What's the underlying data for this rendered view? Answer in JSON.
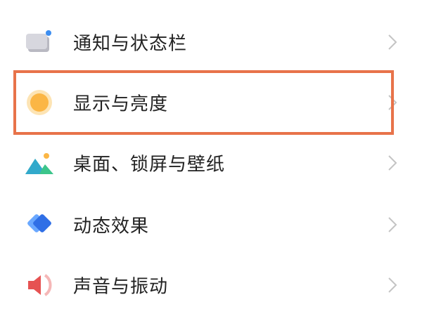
{
  "settings": {
    "items": [
      {
        "label": "通知与状态栏",
        "icon": "notification-bar-icon"
      },
      {
        "label": "显示与亮度",
        "icon": "display-brightness-icon"
      },
      {
        "label": "桌面、锁屏与壁纸",
        "icon": "wallpaper-icon"
      },
      {
        "label": "动态效果",
        "icon": "motion-effects-icon"
      },
      {
        "label": "声音与振动",
        "icon": "sound-vibration-icon"
      }
    ],
    "highlighted_item": "显示与亮度"
  },
  "colors": {
    "highlight_border": "#e8734a",
    "text": "#222222",
    "chevron": "#c4c4c4"
  }
}
